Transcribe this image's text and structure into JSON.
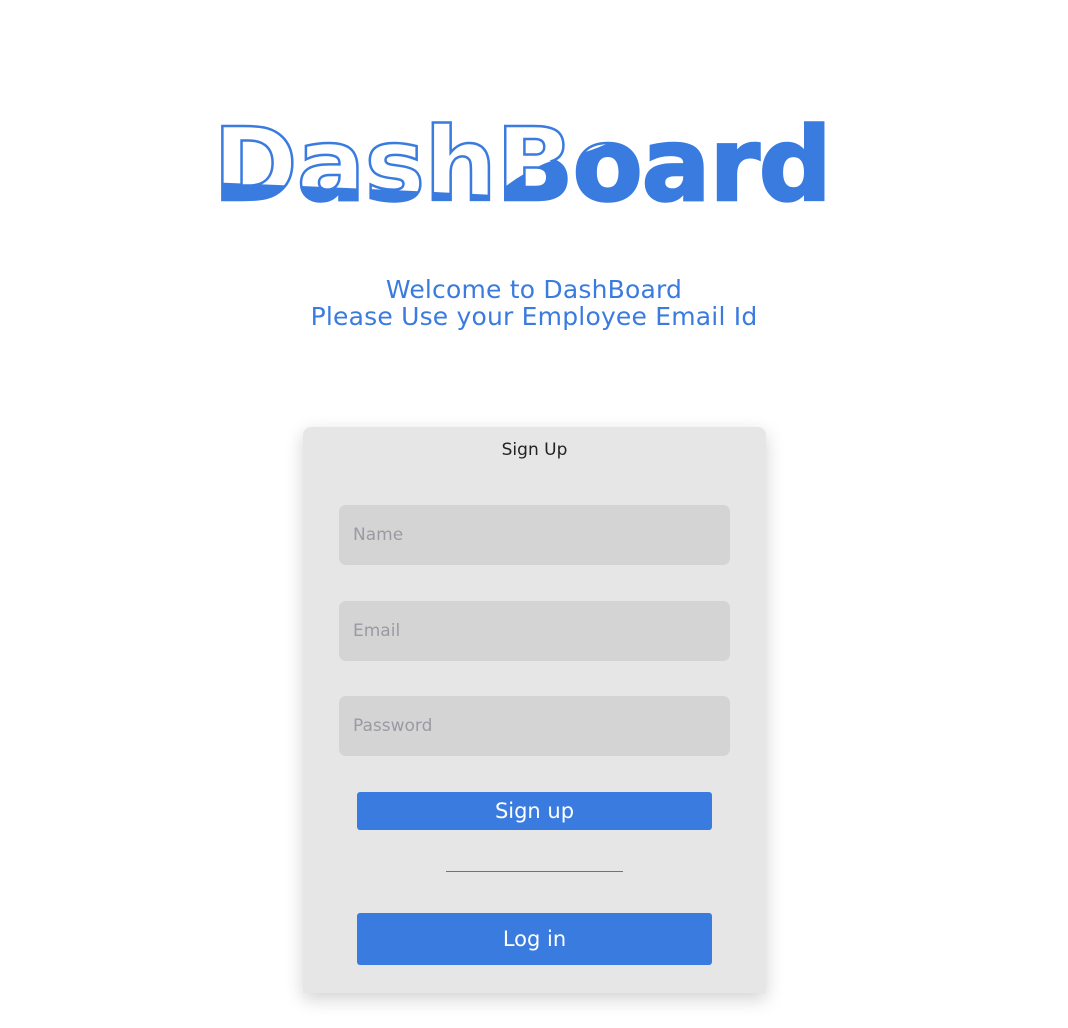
{
  "brand": {
    "logo_part1": "Dash",
    "logo_part2": "Board",
    "accent_color": "#3a7be0"
  },
  "welcome": {
    "line1": "Welcome to DashBoard",
    "line2": "Please Use your Employee Email Id"
  },
  "form": {
    "title": "Sign Up",
    "name_placeholder": "Name",
    "email_placeholder": "Email",
    "password_placeholder": "Password",
    "signup_label": "Sign up",
    "login_label": "Log in"
  }
}
